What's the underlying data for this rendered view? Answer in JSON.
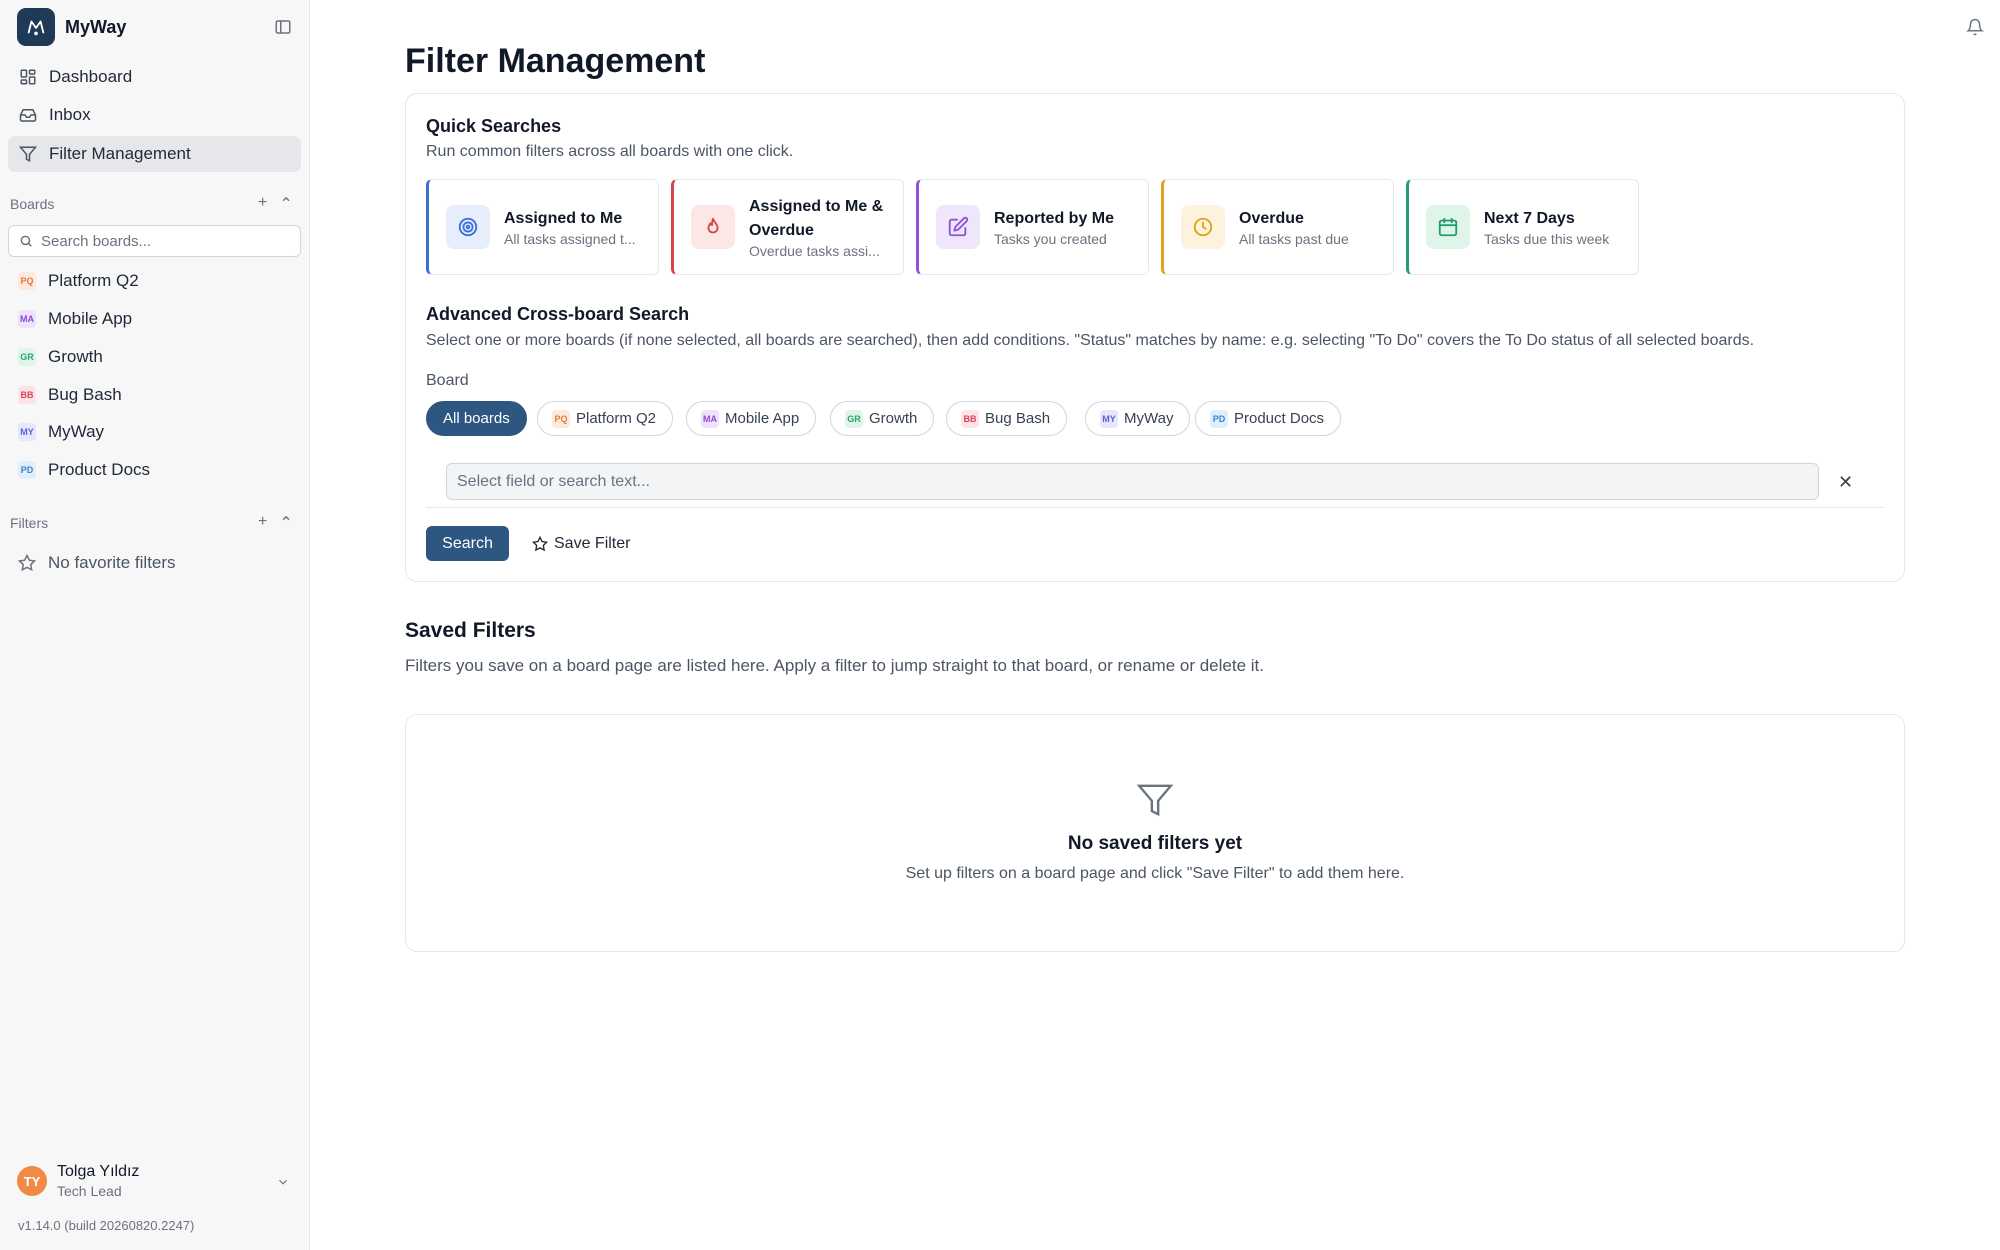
{
  "app": {
    "name": "MyWay",
    "version": "v1.14.0 (build 20260820.2247)"
  },
  "nav": [
    {
      "label": "Dashboard",
      "icon": "grid-icon"
    },
    {
      "label": "Inbox",
      "icon": "inbox-icon"
    },
    {
      "label": "Filter Management",
      "icon": "funnel-icon",
      "active": true
    }
  ],
  "boards": {
    "title": "Boards",
    "search_placeholder": "Search boards...",
    "items": [
      {
        "code": "PQ",
        "label": "Platform Q2",
        "color": "#e8773a",
        "bg": "#fdeadf"
      },
      {
        "code": "MA",
        "label": "Mobile App",
        "color": "#8b49d8",
        "bg": "#efe3fb"
      },
      {
        "code": "GR",
        "label": "Growth",
        "color": "#2aa56b",
        "bg": "#dff5ea"
      },
      {
        "code": "BB",
        "label": "Bug Bash",
        "color": "#d8405a",
        "bg": "#fde2e7"
      },
      {
        "code": "MY",
        "label": "MyWay",
        "color": "#5b5fd6",
        "bg": "#e7e7fb"
      },
      {
        "code": "PD",
        "label": "Product Docs",
        "color": "#3b82d6",
        "bg": "#e0edfb"
      }
    ]
  },
  "filters": {
    "title": "Filters",
    "empty": "No favorite filters"
  },
  "user": {
    "initials": "TY",
    "name": "Tolga Yıldız",
    "role": "Tech Lead"
  },
  "page": {
    "title": "Filter Management"
  },
  "quick": {
    "title": "Quick Searches",
    "subtitle": "Run common filters across all boards with one click.",
    "cards": [
      {
        "title": "Assigned to Me",
        "desc": "All tasks assigned t...",
        "accent": "#3b6fd4",
        "icon_bg": "#e6eefb",
        "icon": "target-icon"
      },
      {
        "title": "Assigned to Me &",
        "title2": "Overdue",
        "desc": "Overdue tasks assi...",
        "accent": "#d64545",
        "icon_bg": "#fde6e6",
        "icon": "flame-icon"
      },
      {
        "title": "Reported by Me",
        "desc": "Tasks you created",
        "accent": "#8b55d6",
        "icon_bg": "#efe6fb",
        "icon": "edit-icon"
      },
      {
        "title": "Overdue",
        "desc": "All tasks past due",
        "accent": "#e0a020",
        "icon_bg": "#fdf2dc",
        "icon": "clock-icon"
      },
      {
        "title": "Next 7 Days",
        "desc": "Tasks due this week",
        "accent": "#22a06b",
        "icon_bg": "#dff5ea",
        "icon": "calendar-icon"
      }
    ]
  },
  "advanced": {
    "title": "Advanced Cross-board Search",
    "description": "Select one or more boards (if none selected, all boards are searched), then add conditions. \"Status\" matches by name: e.g. selecting \"To Do\" covers the To Do status of all selected boards.",
    "board_label": "Board",
    "all_boards": "All boards",
    "condition_placeholder": "Select field or search text...",
    "search_button": "Search",
    "save_button": "Save Filter"
  },
  "saved": {
    "title": "Saved Filters",
    "subtitle": "Filters you save on a board page are listed here. Apply a filter to jump straight to that board, or rename or delete it.",
    "empty_title": "No saved filters yet",
    "empty_text": "Set up filters on a board page and click \"Save Filter\" to add them here."
  }
}
